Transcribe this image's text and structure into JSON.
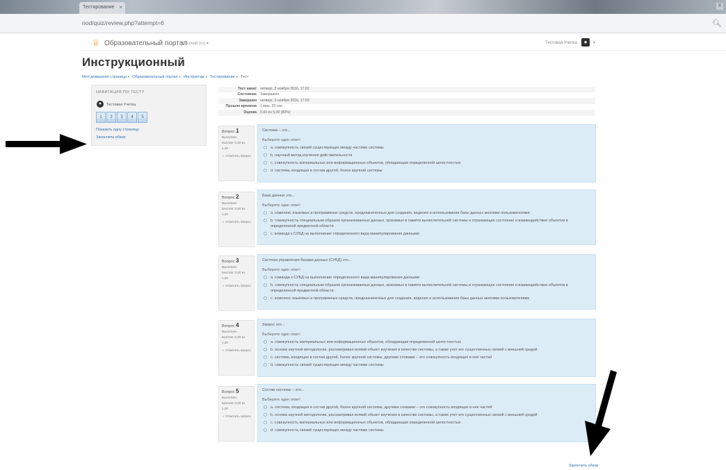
{
  "browser": {
    "tab_title": "Тестирование",
    "close_glyph": "×",
    "window_btn": "X",
    "url": "nod/quiz/review.php?attempt=6",
    "search_icon": "search-icon"
  },
  "navbar": {
    "site_name": "Образовательный портал",
    "language": "Русский (ru) ▾",
    "user_name": "Тестовая Учетка",
    "user_caret": "▾"
  },
  "page": {
    "course_title": "Инструкционный",
    "breadcrumb": [
      "Моя домашняя страница",
      "Образовательный портал",
      "Инструктаж",
      "Тестирование",
      "Тест"
    ],
    "breadcrumb_sep": "▸"
  },
  "nav_block": {
    "title": "НАВИГАЦИЯ ПО ТЕСТУ",
    "user": "Тестовая Учетка",
    "question_buttons": [
      "1",
      "2",
      "3",
      "4",
      "5"
    ],
    "show_one_page": "Показать одну страницу",
    "finish_review": "Закончить обзор"
  },
  "summary": [
    {
      "label": "Тест начат",
      "value": "четверг, 3 ноября 2016, 17:02"
    },
    {
      "label": "Состояние",
      "value": "Завершено"
    },
    {
      "label": "Завершен",
      "value": "четверг, 3 ноября 2016, 17:03"
    },
    {
      "label": "Прошло времени",
      "value": "1 мин. 29 сек."
    },
    {
      "label": "Оценка",
      "value": "5,00 из 5,00 (80%)"
    }
  ],
  "question_info": {
    "question_word": "Вопрос",
    "status": "Выполнен",
    "points": "Баллов: 0,00 из 1,00",
    "flag": "☆ Отметить вопрос"
  },
  "answer_prompt": "Выберите один ответ:",
  "questions": [
    {
      "number": "1",
      "text": "Система – это...",
      "options": [
        "a. совокупность связей существующих между частями системы",
        "b. научный метод изучения действительности",
        "c. совокупность материальных или информационных объектов, обладающая определенной целостностью",
        "d. система, входящая в состав другой, более крупной системы"
      ]
    },
    {
      "number": "2",
      "text": "База данных это...",
      "options": [
        "a. комплекс языковых и программных средств, предназначенных для создания, ведения и использования базы данных многими пользователями",
        "b. совокупность специальным образом организованных данных, хранимых в памяти вычислительной системы и отражающих состояние и взаимодействие объектов в определенной предметной области",
        "c. команда к СУБД на выполнение определенного вида манипулирования данными"
      ]
    },
    {
      "number": "3",
      "text": "Система управления базами данных (СУБД) это...",
      "options": [
        "a. команда к СУБД на выполнение определенного вида манипулирования данными",
        "b. совокупность специальным образом организованных данных, хранимых в памяти вычислительной системы и отражающих состояние и взаимодействие объектов в определенной предметной области",
        "c. комплекс языковых и программных средств, предназначенных для создания, ведения и использования базы данных многими пользователями"
      ]
    },
    {
      "number": "4",
      "text": "Запрос это...",
      "options": [
        "a. совокупность материальных или информационных объектов, обладающая определенной целостностью",
        "b. основа научной методологии, рассматривая всякий объект изучения в качестве системы, а также учет его существенных связей с внешней средой",
        "c. система, входящая в состав другой, более крупной системы, другими словами – это совокупность входящих в нее частей",
        "d. совокупность связей существующих между частями системы"
      ]
    },
    {
      "number": "5",
      "text": "Состав системы – это...",
      "options": [
        "a. система, входящая в состав другой, более крупной системы, другими словами – это совокупность входящих в нее частей",
        "b. основа научной методологии, рассматривая всякий объект изучения в качестве системы, а также учет его существенных связей с внешней средой",
        "c. совокупность материальных или информационных объектов, обладающая определенной целостностью",
        "d. совокупность связей существующих между частями системы"
      ]
    }
  ],
  "bottom": {
    "finish_review": "Закончить обзор"
  }
}
